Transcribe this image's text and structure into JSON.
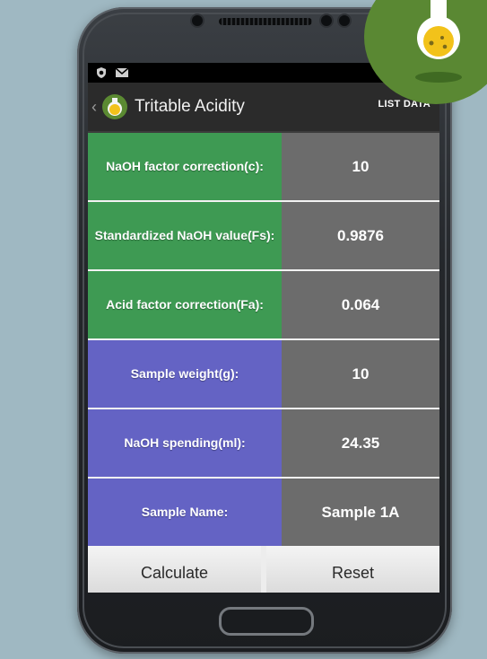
{
  "app": {
    "title": "Tritable Acidity",
    "action": "LIST DATA",
    "back_symbol": "‹"
  },
  "status": {
    "icons": [
      "shield-icon",
      "mail-icon",
      "wifi-icon",
      "signal-icon"
    ]
  },
  "fields": [
    {
      "label": "NaOH factor correction(c):",
      "value": "10",
      "group": "green"
    },
    {
      "label": "Standardized NaOH value(Fs):",
      "value": "0.9876",
      "group": "green"
    },
    {
      "label": "Acid factor correction(Fa):",
      "value": "0.064",
      "group": "green"
    },
    {
      "label": "Sample weight(g):",
      "value": "10",
      "group": "blue"
    },
    {
      "label": "NaOH spending(ml):",
      "value": "24.35",
      "group": "blue"
    },
    {
      "label": "Sample Name:",
      "value": "Sample 1A",
      "group": "blue"
    }
  ],
  "buttons": {
    "calculate": "Calculate",
    "reset": "Reset"
  },
  "colors": {
    "green_label": "#3e9a53",
    "blue_label": "#6463c4",
    "value_bg": "#6c6c6c",
    "badge": "#5a8833",
    "flask_liquid": "#f2c21a"
  }
}
